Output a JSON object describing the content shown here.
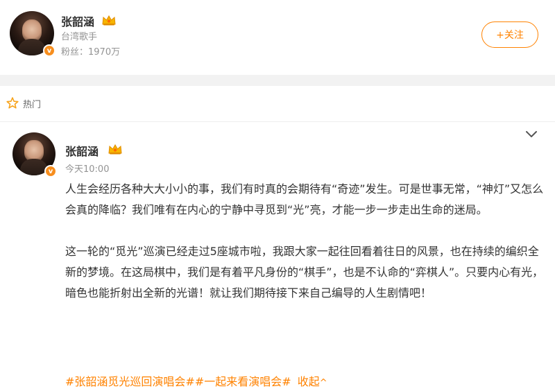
{
  "profile": {
    "name": "张韶涵",
    "bio": "台湾歌手",
    "fans_label": "粉丝：1970万",
    "follow_button": "+关注",
    "verified_badge": "v",
    "accent_color": "#ff8200"
  },
  "section": {
    "label": "热门",
    "icon": "star-icon"
  },
  "post": {
    "author": "张韶涵",
    "timestamp": "今天10:00",
    "verified_badge": "v",
    "paragraphs": [
      "人生会经历各种大大小小的事，我们有时真的会期待有“奇迹”发生。可是世事无常，“神灯”又怎么会真的降临？我们唯有在内心的宁静中寻觅到“光”亮，才能一步一步走出生命的迷局。",
      "这一轮的“觅光”巡演已经走过5座城市啦，我跟大家一起往回看着往日的风景，也在持续的编织全新的梦境。在这局棋中，我们是有着平凡身份的“棋手”，也是不认命的“弈棋人”。只要内心有光，暗色也能折射出全新的光谱！就让我们期待接下来自己编导的人生剧情吧！"
    ],
    "hashtags": [
      "#张韶涵觅光巡回演唱会#",
      "#一起来看演唱会#"
    ],
    "collapse_label": "收起",
    "collapse_caret": "^"
  }
}
